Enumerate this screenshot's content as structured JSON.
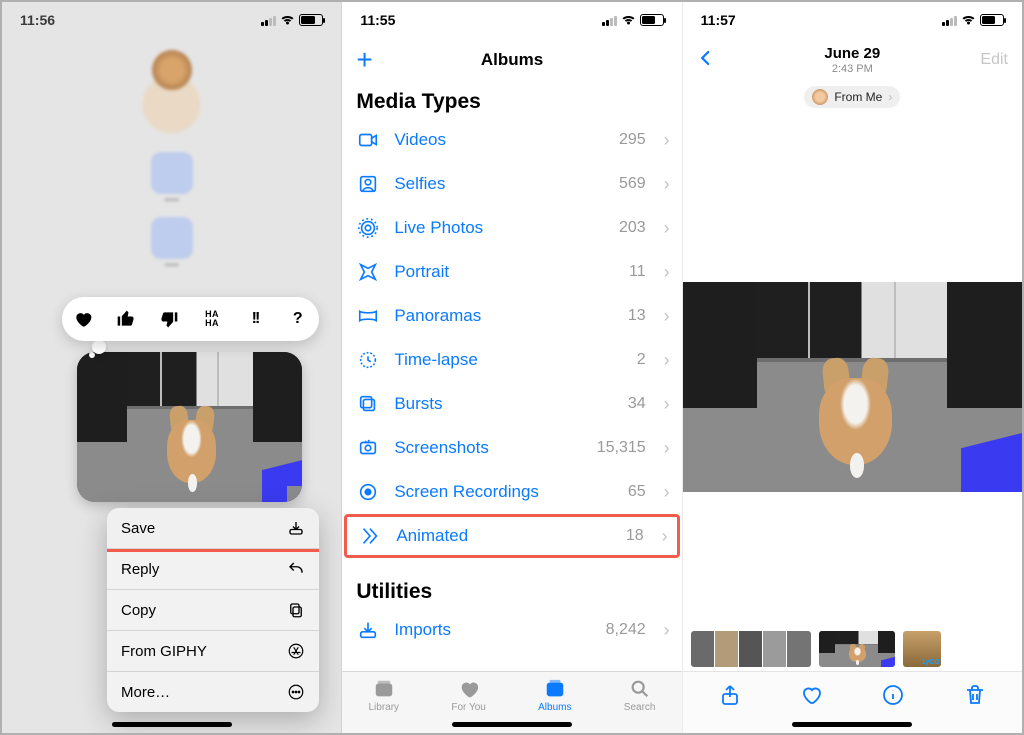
{
  "phone1": {
    "time": "11:56",
    "reactions": [
      "heart",
      "thumbs-up",
      "thumbs-down",
      "haha",
      "exclaim",
      "question"
    ],
    "haha_label": "HA\nHA",
    "menu": {
      "save": {
        "label": "Save",
        "highlight": true
      },
      "reply": {
        "label": "Reply"
      },
      "copy": {
        "label": "Copy"
      },
      "giphy": {
        "label": "From GIPHY"
      },
      "more": {
        "label": "More…"
      }
    }
  },
  "phone2": {
    "time": "11:55",
    "nav_title": "Albums",
    "sections": {
      "media_types": {
        "title": "Media Types",
        "rows": [
          {
            "key": "videos",
            "label": "Videos",
            "count": "295"
          },
          {
            "key": "selfies",
            "label": "Selfies",
            "count": "569"
          },
          {
            "key": "live",
            "label": "Live Photos",
            "count": "203"
          },
          {
            "key": "portrait",
            "label": "Portrait",
            "count": "11"
          },
          {
            "key": "pano",
            "label": "Panoramas",
            "count": "13"
          },
          {
            "key": "timelapse",
            "label": "Time-lapse",
            "count": "2"
          },
          {
            "key": "bursts",
            "label": "Bursts",
            "count": "34"
          },
          {
            "key": "screenshots",
            "label": "Screenshots",
            "count": "15,315"
          },
          {
            "key": "screenrec",
            "label": "Screen Recordings",
            "count": "65"
          },
          {
            "key": "animated",
            "label": "Animated",
            "count": "18",
            "highlight": true
          }
        ]
      },
      "utilities": {
        "title": "Utilities",
        "rows": [
          {
            "key": "imports",
            "label": "Imports",
            "count": "8,242"
          }
        ]
      }
    },
    "tabs": [
      {
        "key": "library",
        "label": "Library"
      },
      {
        "key": "foryou",
        "label": "For You"
      },
      {
        "key": "albums",
        "label": "Albums",
        "active": true
      },
      {
        "key": "search",
        "label": "Search"
      }
    ]
  },
  "phone3": {
    "time": "11:57",
    "date": "June 29",
    "subtime": "2:43 PM",
    "edit_label": "Edit",
    "from_label": "From Me",
    "toolbar": [
      "share",
      "favorite",
      "info",
      "trash"
    ]
  }
}
